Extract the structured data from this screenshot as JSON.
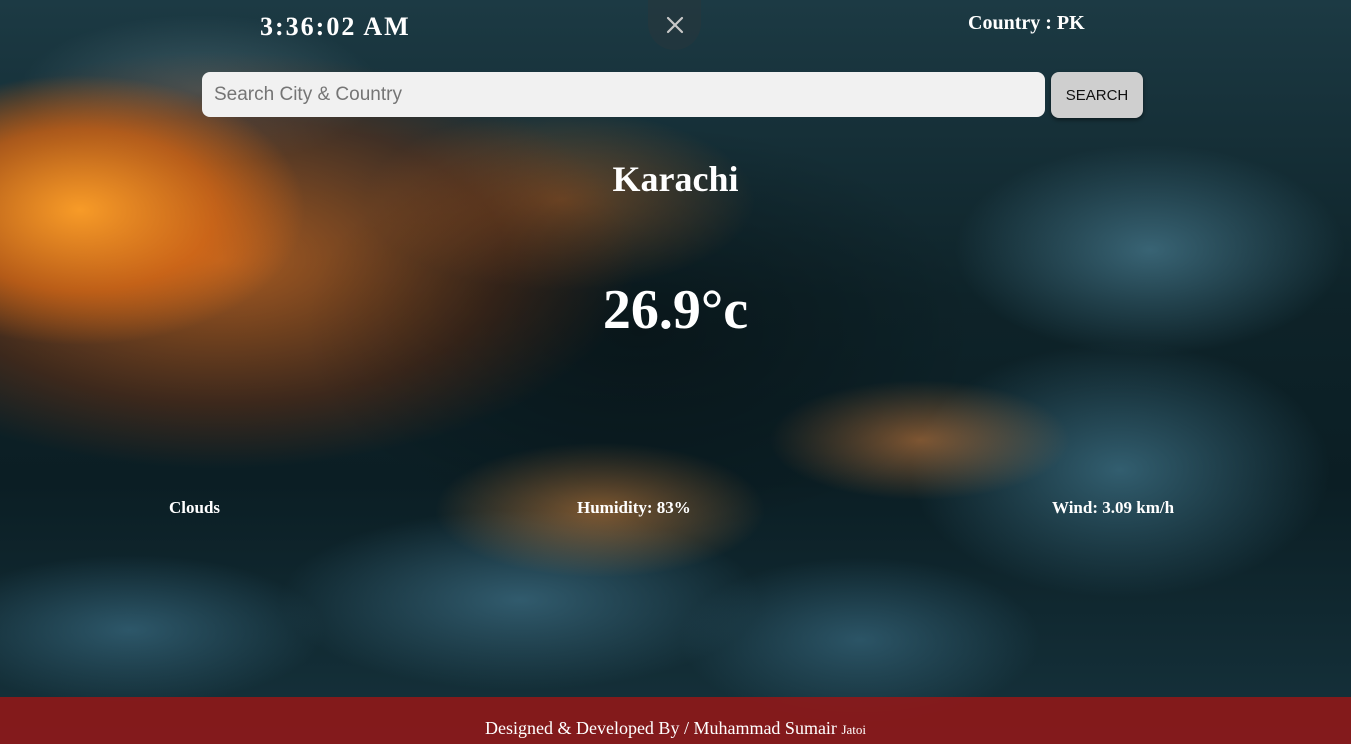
{
  "header": {
    "clock": "3:36:02 AM",
    "country_text": "Country : PK"
  },
  "search": {
    "placeholder": "Search City & Country",
    "value": "",
    "button_label": "SEARCH"
  },
  "weather": {
    "city": "Karachi",
    "temperature": "26.9°c",
    "condition": "Clouds",
    "humidity": "Humidity: 83%",
    "wind": "Wind: 3.09 km/h"
  },
  "footer": {
    "credit_main": "Designed & Developed By / Muhammad Sumair",
    "credit_small": "Jatoi"
  },
  "icons": {
    "close": "close-icon"
  },
  "colors": {
    "footer_bg": "#961616",
    "text": "#ffffff",
    "search_bg": "#f1f1f1",
    "button_bg": "#cfcfcf"
  }
}
